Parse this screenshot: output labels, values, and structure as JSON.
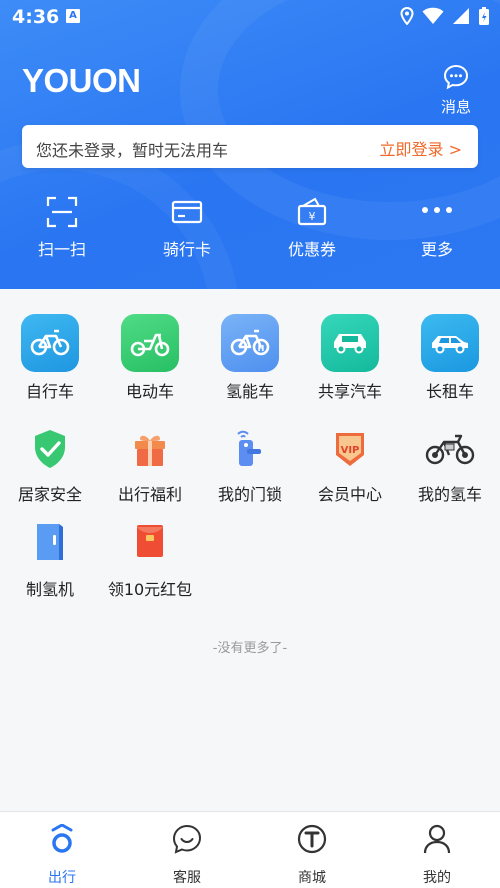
{
  "status_bar": {
    "time": "4:36",
    "notification_badge": "A"
  },
  "header": {
    "logo": "YOUON",
    "message_label": "消息",
    "login_tip": "您还未登录，暂时无法用车",
    "login_link": "立即登录 >"
  },
  "quick_actions": [
    {
      "label": "扫一扫",
      "icon": "scan-icon"
    },
    {
      "label": "骑行卡",
      "icon": "card-icon"
    },
    {
      "label": "优惠券",
      "icon": "coupon-icon"
    },
    {
      "label": "更多",
      "icon": "more-icon"
    }
  ],
  "services_row1": [
    {
      "label": "自行车",
      "icon": "bicycle-icon",
      "color": "#2aa8ea"
    },
    {
      "label": "电动车",
      "icon": "ebike-icon",
      "color": "#3ccf76"
    },
    {
      "label": "氢能车",
      "icon": "hydrogen-bike-icon",
      "color": "#5b9df3"
    },
    {
      "label": "共享汽车",
      "icon": "shared-car-icon",
      "color": "#20c4a8"
    },
    {
      "label": "长租车",
      "icon": "rental-car-icon",
      "color": "#27a7e8"
    }
  ],
  "services_row2": [
    {
      "label": "居家安全",
      "icon": "shield-check-icon"
    },
    {
      "label": "出行福利",
      "icon": "gift-icon"
    },
    {
      "label": "我的门锁",
      "icon": "door-lock-icon"
    },
    {
      "label": "会员中心",
      "icon": "vip-badge-icon"
    },
    {
      "label": "我的氢车",
      "icon": "my-hydrogen-bike-icon"
    }
  ],
  "services_row3": [
    {
      "label": "制氢机",
      "icon": "hydrogen-machine-icon"
    },
    {
      "label": "领10元红包",
      "icon": "red-packet-icon"
    }
  ],
  "no_more": "-没有更多了-",
  "tabs": [
    {
      "label": "出行",
      "icon": "travel-icon",
      "active": true
    },
    {
      "label": "客服",
      "icon": "chat-icon",
      "active": false
    },
    {
      "label": "商城",
      "icon": "mall-icon",
      "active": false
    },
    {
      "label": "我的",
      "icon": "user-icon",
      "active": false
    }
  ],
  "colors": {
    "primary": "#2a76f2",
    "accent": "#ef6a2a",
    "background": "#f6f7f9"
  }
}
